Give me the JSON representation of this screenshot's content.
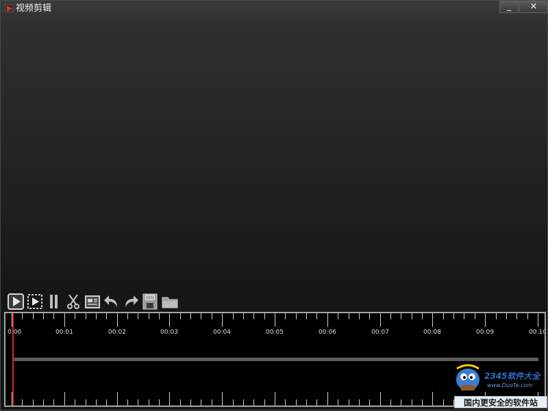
{
  "window": {
    "title": "视频剪辑",
    "minimize_label": "_",
    "close_label": "×"
  },
  "toolbar": {
    "tools": [
      {
        "name": "play",
        "icon": "play-icon"
      },
      {
        "name": "play-selection",
        "icon": "play-selection-icon"
      },
      {
        "name": "pause",
        "icon": "pause-icon"
      },
      {
        "name": "cut",
        "icon": "scissors-icon"
      },
      {
        "name": "preview-clip",
        "icon": "clip-preview-icon"
      },
      {
        "name": "undo",
        "icon": "undo-icon"
      },
      {
        "name": "redo",
        "icon": "redo-icon"
      },
      {
        "name": "save",
        "icon": "save-icon"
      },
      {
        "name": "open-folder",
        "icon": "folder-icon"
      }
    ]
  },
  "timeline": {
    "labels": [
      "0:00",
      "00:01",
      "00:02",
      "00:03",
      "00:04",
      "00:05",
      "00:06",
      "00:07",
      "00:08",
      "00:09",
      "00:10"
    ],
    "playhead_time": "0:00"
  },
  "watermark": {
    "brand": "2345软件大全",
    "url": "www.DuoTe.com",
    "slogan": "国内更安全的软件站"
  },
  "colors": {
    "playhead": "#e02020",
    "timeline_bg": "#000000",
    "track_bar": "#5c5c5c"
  }
}
